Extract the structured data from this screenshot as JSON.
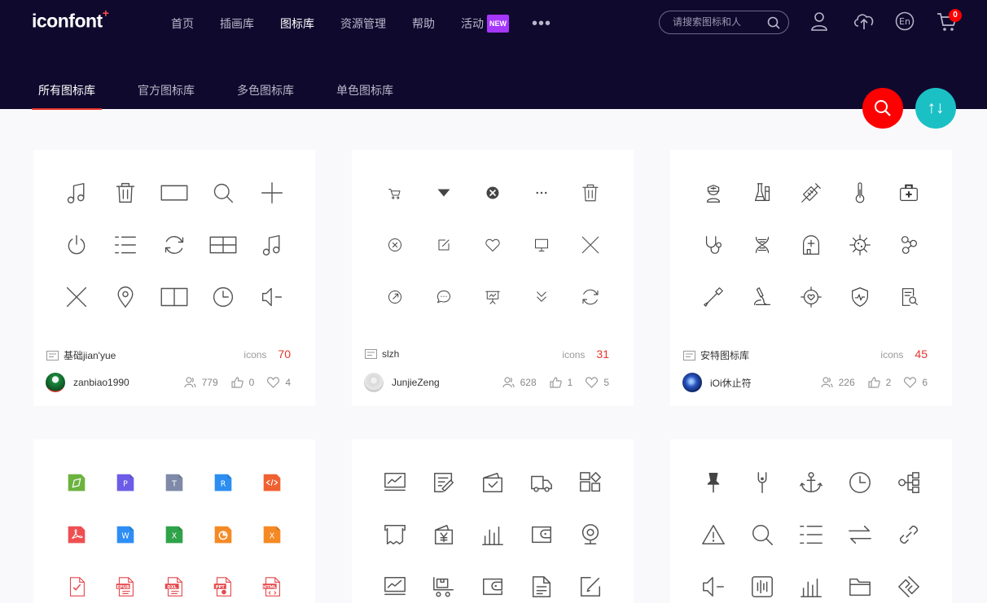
{
  "header": {
    "logo": "iconfont",
    "nav": [
      {
        "label": "首页",
        "active": false
      },
      {
        "label": "插画库",
        "active": false
      },
      {
        "label": "图标库",
        "active": true
      },
      {
        "label": "资源管理",
        "active": false
      },
      {
        "label": "帮助",
        "active": false
      },
      {
        "label": "活动",
        "active": false,
        "badge": "NEW"
      }
    ],
    "search_placeholder": "请搜索图标和人",
    "cart_count": "0"
  },
  "subnav": [
    {
      "label": "所有图标库",
      "active": true
    },
    {
      "label": "官方图标库",
      "active": false
    },
    {
      "label": "多色图标库",
      "active": false
    },
    {
      "label": "单色图标库",
      "active": false
    }
  ],
  "fab": {
    "sort_label": "↑↓"
  },
  "colors": {
    "header_bg": "#10092e",
    "accent_red": "#e8342e",
    "fab_search": "#ff0000",
    "fab_sort": "#1bc0c5"
  },
  "cards": [
    {
      "name": "基础jian'yue",
      "count_label": "icons",
      "count": "70",
      "author": "zanbiao1990",
      "views": "779",
      "likes": "0",
      "favs": "4",
      "icons": [
        "music-note-icon",
        "trash-icon",
        "rectangle-icon",
        "search-icon",
        "plus-icon",
        "power-icon",
        "list-icon",
        "refresh-icon",
        "grid-icon",
        "music-note-icon",
        "close-icon",
        "location-pin-icon",
        "split-view-icon",
        "clock-icon",
        "speaker-icon"
      ]
    },
    {
      "name": "slzh",
      "count_label": "icons",
      "count": "31",
      "author": "JunjieZeng",
      "views": "628",
      "likes": "1",
      "favs": "5",
      "icons": [
        "cart-icon",
        "triangle-down-icon",
        "close-circle-filled-icon",
        "more-dots-icon",
        "trash-icon",
        "close-circle-icon",
        "edit-icon",
        "heart-icon",
        "monitor-icon",
        "close-icon",
        "share-icon",
        "chat-icon",
        "presentation-icon",
        "double-chevron-down-icon",
        "refresh-icon"
      ]
    },
    {
      "name": "安特图标库",
      "count_label": "icons",
      "count": "45",
      "author": "iOi休止符",
      "views": "226",
      "likes": "2",
      "favs": "6",
      "icons": [
        "nurse-icon",
        "flask-icon",
        "syringe-icon",
        "thermometer-icon",
        "medical-kit-icon",
        "stethoscope-icon",
        "dna-icon",
        "hospital-icon",
        "virus-icon",
        "molecule-icon",
        "pipette-icon",
        "microscope-icon",
        "heart-target-icon",
        "shield-pulse-icon",
        "report-search-icon"
      ]
    },
    {
      "name": "",
      "count_label": "",
      "count": "",
      "author": "",
      "views": "",
      "likes": "",
      "favs": "",
      "icons": [
        "file-green-icon",
        "file-p-icon",
        "file-t-icon",
        "file-r-icon",
        "file-code-icon",
        "file-pdf-icon",
        "file-word-icon",
        "file-excel-icon",
        "file-ppt-icon",
        "file-x-icon",
        "file-check-icon",
        "file-epub-icon",
        "file-dxl-icon",
        "file-ppt-line-icon",
        "file-html-icon"
      ]
    },
    {
      "name": "",
      "count_label": "",
      "count": "",
      "author": "",
      "views": "",
      "likes": "",
      "favs": "",
      "icons": [
        "chart-monitor-icon",
        "note-edit-icon",
        "wallet-check-icon",
        "truck-icon",
        "apps-icon",
        "receipt-icon",
        "yen-wallet-icon",
        "bar-chart-icon",
        "wallet-icon",
        "webcam-icon",
        "chart-monitor-icon",
        "box-cart-icon",
        "card-wallet-icon",
        "document-icon",
        "edit-square-icon"
      ]
    },
    {
      "name": "",
      "count_label": "",
      "count": "",
      "author": "",
      "views": "",
      "likes": "",
      "favs": "",
      "icons": [
        "pushpin-icon",
        "tuning-fork-icon",
        "anchor-icon",
        "clock-icon",
        "network-icon",
        "warning-icon",
        "search-icon",
        "list-icon",
        "transfer-icon",
        "link-icon",
        "speaker-icon",
        "audio-wave-icon",
        "bar-chart-icon",
        "folder-icon",
        "diamond-link-icon"
      ]
    }
  ]
}
